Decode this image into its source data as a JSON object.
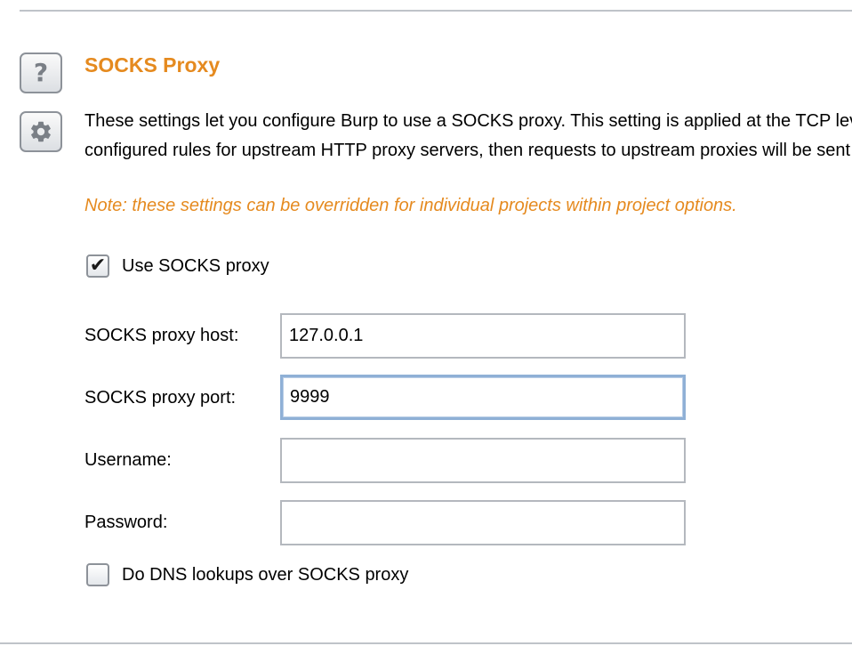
{
  "section": {
    "title": "SOCKS Proxy",
    "description_lines": [
      "These settings let you configure Burp to use a SOCKS proxy. This setting is applied at the TCP level, and all outbound requests will be sent via this proxy. If you have",
      "configured rules for upstream HTTP proxy servers, then requests to upstream proxies will be sent via the SOCKS proxy configured here."
    ],
    "note": "Note: these settings can be overridden for individual projects within project options."
  },
  "sidebar": {
    "help_icon": "help-icon",
    "help_glyph": "?",
    "settings_icon": "gear-icon"
  },
  "form": {
    "use_socks": {
      "label": "Use SOCKS proxy",
      "checked": true,
      "check_glyph": "✔"
    },
    "host": {
      "label": "SOCKS proxy host:",
      "value": "127.0.0.1"
    },
    "port": {
      "label": "SOCKS proxy port:",
      "value": "9999"
    },
    "username": {
      "label": "Username:",
      "value": ""
    },
    "password": {
      "label": "Password:",
      "value": ""
    },
    "dns": {
      "label": "Do DNS lookups over SOCKS proxy",
      "checked": false
    }
  },
  "colors": {
    "accent": "#e58a1f",
    "field_border": "#b4b8be",
    "focus_border": "#8fb0d6"
  }
}
